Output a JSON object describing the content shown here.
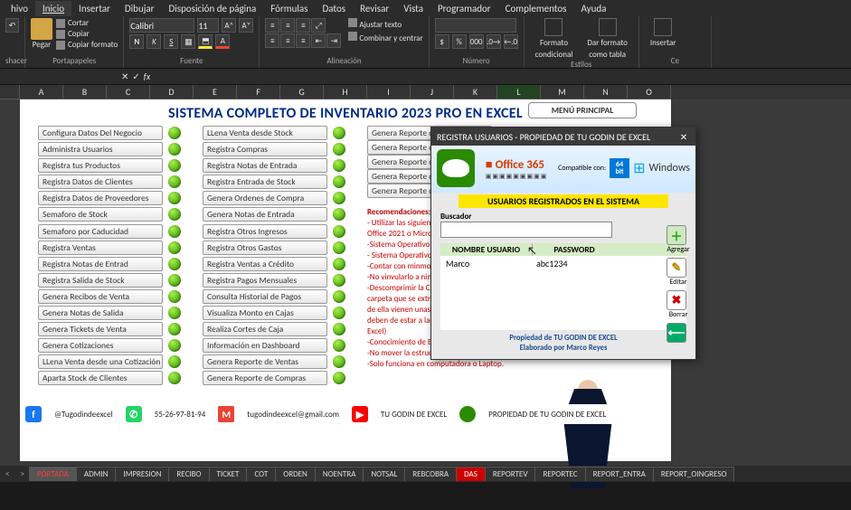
{
  "menu": [
    "hivo",
    "Inicio",
    "Insertar",
    "Dibujar",
    "Disposición de página",
    "Fórmulas",
    "Datos",
    "Revisar",
    "Vista",
    "Programador",
    "Complementos",
    "Ayuda"
  ],
  "menu_active_index": 1,
  "ribbon": {
    "undo_group": "shacer",
    "clipboard": {
      "paste": "Pegar",
      "cut": "Cortar",
      "copy": "Copiar",
      "format": "Copiar formato",
      "label": "Portapapeles"
    },
    "font": {
      "name": "Calibri",
      "size": "11",
      "label": "Fuente"
    },
    "align": {
      "wrap": "Ajustar texto",
      "merge": "Combinar y centrar",
      "label": "Alineación"
    },
    "number": {
      "label": "Número"
    },
    "cond": {
      "label1": "Formato",
      "label2": "condicional"
    },
    "table": {
      "label1": "Dar formato",
      "label2": "como tabla"
    },
    "styles_label": "Estilos",
    "insert": {
      "label": "Insertar"
    },
    "cells_partial": "Ce"
  },
  "namebox": "",
  "columns": [
    "A",
    "B",
    "C",
    "D",
    "E",
    "F",
    "G",
    "H",
    "I",
    "J",
    "K",
    "L",
    "M",
    "N",
    "O"
  ],
  "active_col_index": 11,
  "page_title": "SISTEMA COMPLETO DE INVENTARIO 2023 PRO EN EXCEL",
  "menu_principal": "MENÚ PRINCIPAL",
  "col1": [
    "Configura Datos Del Negocio",
    "Administra Usuarios",
    "Registra tus Productos",
    "Registra Datos de Clientes",
    "Registra Datos de Proveedores",
    "Semaforo de Stock",
    "Semaforo por Caducidad",
    "Registra Ventas",
    "Registra Notas de Entrad",
    "Registra Salida de Stock",
    "Genera Recibos de Venta",
    "Genera Notas de Salida",
    "Genera Tickets de Venta",
    "Genera Cotizaciones",
    "LLena Venta desde una Cotización",
    "Aparta Stock de Clientes"
  ],
  "col2": [
    "LLena Venta desde Stock",
    "Registra Compras",
    "Registra Notas de Entrada",
    "Registra Entrada de Stock",
    "Genera Ordenes de Compra",
    "Genera Notas de Entrada",
    "Registra Otros Ingresos",
    "Registra Otros Gastos",
    "Registra Ventas a Crédito",
    "Registra Pagos Mensuales",
    "Consulta Historial de Pagos",
    "Visualiza Monto en Cajas",
    "Realiza Cortes de Caja",
    "Información en Dashboard",
    "Genera Reporte de Ventas",
    "Genera Reporte de Compras"
  ],
  "col3": [
    "Genera Reporte de En",
    "Genera Reporte de Sa",
    "Genera Reporte de O.",
    "Genera Reporte de O.",
    "Genera Reporte de C"
  ],
  "recs": {
    "title": "Recomendaciones:",
    "lines": [
      "- Utilizar las siguiente",
      "Office 2021 o Microso",
      "-Sistema Operativo W",
      "- Sistema Operativo a",
      "-Contar con minmo 4",
      "-No vinvularlo a ningu",
      "-Descomprimir la Cap",
      "carpeta que se extrajo",
      "de ella vienen unas s",
      "deben de estar a lado de este archivo de",
      "Excel)",
      "-Conocimiento de Excel Basicos",
      "-No mover la estructura de las hojas",
      "-Solo funciona en computadora o Laptop."
    ]
  },
  "footer": {
    "fb": "@Tugodindeexcel",
    "wa": "55-26-97-81-94",
    "gm": "tugodindeexcel@gmail.com",
    "yt": "TU GODIN DE EXCEL",
    "owner": "PROPIEDAD DE TU GODIN DE EXCEL"
  },
  "dialog": {
    "title": "REGISTRA USUARIOS - PROPIEDAD DE TU GODIN DE EXCEL",
    "compatible": "Compatible con:",
    "office": "Office 365",
    "bit_top": "64",
    "bit_bot": "bit",
    "windows": "Windows",
    "band": "USUARIOS REGISTRADOS EN EL SISTEMA",
    "search_label": "Buscador",
    "search_value": "",
    "col_user": "NOMBRE USUARIO",
    "col_pass": "PASSWORD",
    "row_user": "Marco",
    "row_pass": "abc1234",
    "add": "Agregar",
    "edit": "Editar",
    "del": "Borrar",
    "foot1": "Propiedad de TU GODIN DE EXCEL",
    "foot2": "Elaborado por Marco Reyes"
  },
  "tabs": [
    "PORTADA",
    "ADMIN",
    "IMPRESION",
    "RECIBO",
    "TICKET",
    "COT",
    "ORDEN",
    "NOENTRA",
    "NOTSAL",
    "REBCOBRA",
    "DAS",
    "REPORTEV",
    "REPORTEC",
    "REPORT_ENTRA",
    "REPORT_OINGRESO"
  ],
  "tabs_red": [
    0
  ],
  "tabs_active_index": 0,
  "tabs_das_index": 10
}
